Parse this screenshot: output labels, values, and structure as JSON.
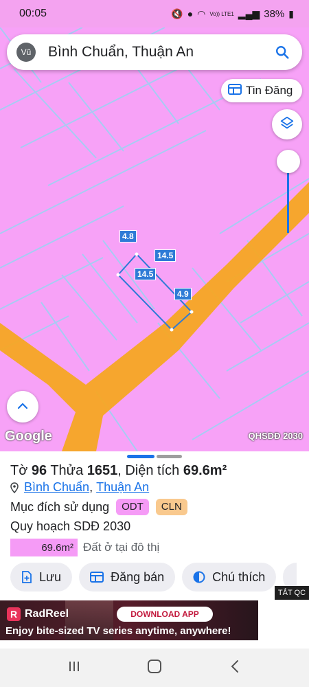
{
  "status_bar": {
    "time": "00:05",
    "network": "Vo)) LTE1",
    "battery": "38%"
  },
  "search": {
    "avatar_initials": "Vũ",
    "query": "Bình Chuẩn, Thuận An"
  },
  "map": {
    "tin_dang_label": "Tin Đăng",
    "google_label": "Google",
    "plan_label": "QHSDĐ 2030",
    "dimensions": {
      "top": "4.8",
      "right_edge": "14.5",
      "left_edge": "14.5",
      "bottom": "4.9"
    },
    "zoom_level_fraction": 0.85
  },
  "parcel": {
    "sheet_prefix": "Tờ ",
    "sheet_no": "96",
    "plot_prefix": " Thửa ",
    "plot_no": "1651",
    "area_prefix": ", Diện tích ",
    "area": "69.6m²",
    "ward": "Bình Chuẩn",
    "separator": ",",
    "city": "Thuận An",
    "purpose_label": "Mục đích sử dụng",
    "purpose_tags": [
      "ODT",
      "CLN"
    ],
    "plan_label": "Quy hoạch SDĐ 2030",
    "plan_area": "69.6m²",
    "plan_desc": "Đất ở tại đô thị"
  },
  "actions": {
    "save": "Lưu",
    "sell": "Đăng bán",
    "legend": "Chú thích"
  },
  "ad": {
    "tag": "TẮT QC",
    "brand": "RadReel",
    "logo_letter": "R",
    "cta": "DOWNLOAD APP",
    "tagline": "Enjoy bite-sized TV series anytime, anywhere!"
  },
  "colors": {
    "map_background": "#f7a2f7",
    "road": "#f5a623",
    "accent": "#1a73e8"
  }
}
